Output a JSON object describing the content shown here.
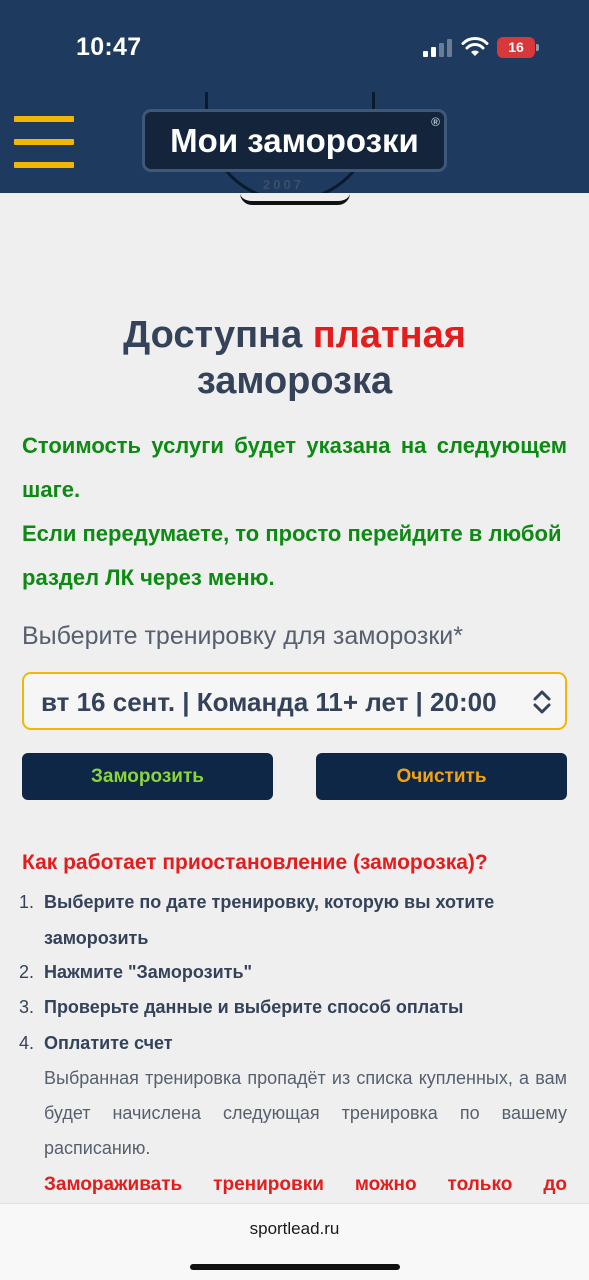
{
  "status": {
    "time": "10:47",
    "battery": "16"
  },
  "header": {
    "title": "Мои заморозки",
    "registered_mark": "®",
    "logo_year": "2007"
  },
  "heading": {
    "part1": "Доступна ",
    "part_red": "платная",
    "part2": "заморозка"
  },
  "info": {
    "line1": "Стоимость услуги будет указана на следующем шаге.",
    "line2": "Если передумаете, то просто перейдите в любой раздел ЛК через меню."
  },
  "form": {
    "select_label": "Выберите тренировку для заморозки*",
    "selected_value": "вт 16 сент. | Команда 11+ лет | 20:00",
    "freeze_label": "Заморозить",
    "clear_label": "Очистить"
  },
  "how": {
    "title": "Как работает приостановление (заморозка)?",
    "steps": [
      {
        "num": "1.",
        "text": "Выберите по дате тренировку, которую вы хотите заморозить"
      },
      {
        "num": "2.",
        "text": "Нажмите \"Заморозить\""
      },
      {
        "num": "3.",
        "text": "Проверьте данные и выберите способ оплаты"
      },
      {
        "num": "4.",
        "text": "Оплатите счет"
      }
    ],
    "description": "Выбранная тренировка пропадёт из списка купленных, а вам будет начислена следующая тренировка по вашему расписанию.",
    "warning": "Замораживать тренировки можно только до"
  },
  "browser": {
    "url": "sportlead.ru"
  },
  "colors": {
    "nav_bg": "#1e3a5f",
    "accent_yellow": "#f2b705",
    "green_text": "#0c8a12",
    "red_text": "#e41c1c",
    "button_bg": "#0f2747"
  }
}
